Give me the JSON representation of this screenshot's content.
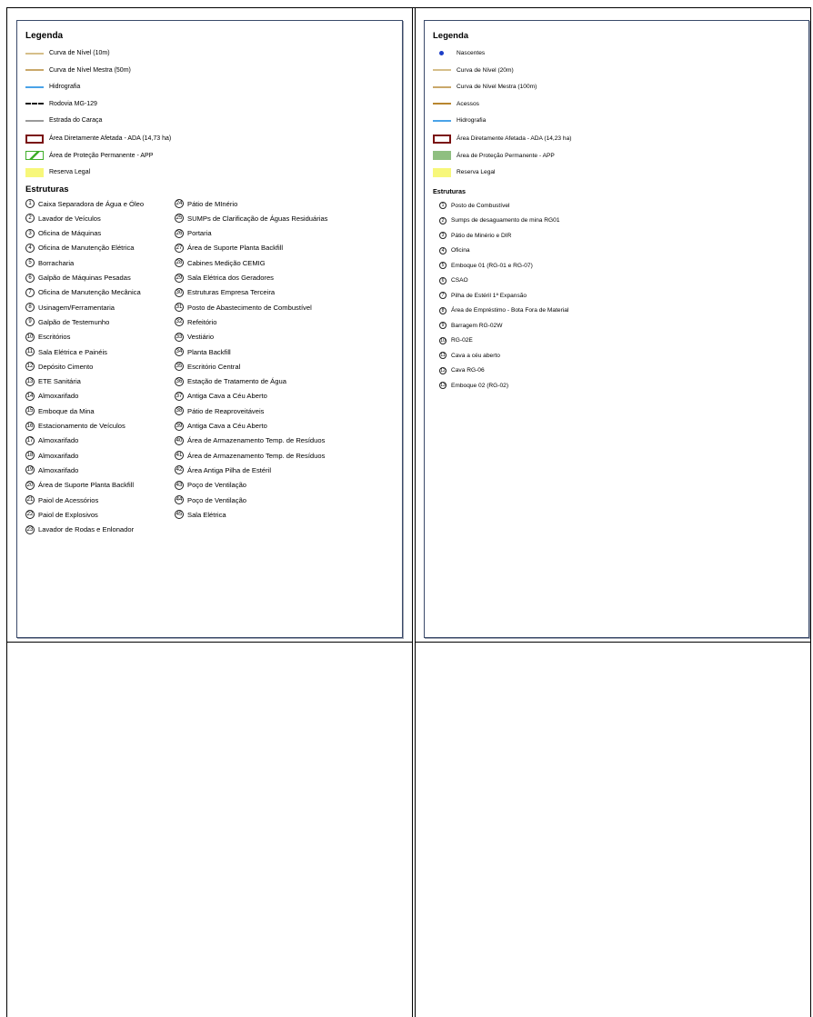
{
  "left": {
    "legend_title": "Legenda",
    "legend": [
      {
        "label": "Curva de Nível (10m)",
        "symbol": "line",
        "color": "#d6bf8a"
      },
      {
        "label": "Curva de Nível Mestra (50m)",
        "symbol": "line",
        "color": "#c9a86a"
      },
      {
        "label": "Hidrografia",
        "symbol": "line",
        "color": "#4aa3e8"
      },
      {
        "label": "Rodovia MG-129",
        "symbol": "dash",
        "color": "#1a1a1a"
      },
      {
        "label": "Estrada do Caraça",
        "symbol": "line",
        "color": "#9a9a9a"
      },
      {
        "label": "Área Diretamente Afetada - ADA (14,73 ha)",
        "symbol": "box-outline",
        "color": "#7a1111"
      },
      {
        "label": "Área de Proteção Permanente - APP",
        "symbol": "box-hatch",
        "color": "#3fae2a"
      },
      {
        "label": "Reserva Legal",
        "symbol": "box-fill",
        "color": "#f7f77a"
      }
    ],
    "structures_title": "Estruturas",
    "structures": [
      "Caixa Separadora de Água e Óleo",
      "Lavador de Veículos",
      "Oficina de Máquinas",
      "Oficina de Manutenção Elétrica",
      "Borracharia",
      "Galpão de Máquinas Pesadas",
      "Oficina de Manutenção Mecânica",
      "Usinagem/Ferramentaria",
      "Galpão de Testemunho",
      "Escritórios",
      "Sala Elétrica e Painéis",
      "Depósito Cimento",
      "ETE Sanitária",
      "Almoxarifado",
      "Emboque da Mina",
      "Estacionamento de Veículos",
      "Almoxarifado",
      "Almoxarifado",
      "Almoxarifado",
      "Área de Suporte Planta Backfill",
      "Paiol de Acessórios",
      "Paiol de Explosivos",
      "Lavador de Rodas e Enlonador",
      "Pátio de MInério",
      "SUMPs de Clarificação de Águas Residuárias",
      "Portaria",
      "Área de Suporte Planta Backfill",
      "Cabines Medição CEMIG",
      "Sala Elétrica dos Geradores",
      "Estruturas Empresa Terceira",
      "Posto de Abastecimento de Combustível",
      "Refeitório",
      "Vestiário",
      "Planta Backfill",
      "Escritório Central",
      "Estação de Tratamento de Água",
      "Antiga Cava a Céu Aberto",
      "Pátio de Reaproveitáveis",
      "Antiga Cava a Céu Aberto",
      "Área de Armazenamento Temp. de Resíduos",
      "Área de Armazenamento Temp. de Resíduos",
      "Área Antiga Pilha de Estéril",
      "Poço de Ventilação",
      "Poço de Ventilação",
      "Sala Elétrica"
    ]
  },
  "right": {
    "legend_title": "Legenda",
    "legend": [
      {
        "label": "Nascentes",
        "symbol": "dot",
        "color": "#1c3ec7"
      },
      {
        "label": "Curva de Nível (20m)",
        "symbol": "line",
        "color": "#d6bf8a"
      },
      {
        "label": "Curva de Nível Mestra (100m)",
        "symbol": "line",
        "color": "#c9a86a"
      },
      {
        "label": "Acessos",
        "symbol": "line",
        "color": "#b8862f"
      },
      {
        "label": "Hidrografia",
        "symbol": "line",
        "color": "#4aa3e8"
      },
      {
        "label": "Área Diretamente Afetada - ADA (14,23 ha)",
        "symbol": "box-outline",
        "color": "#7a1111"
      },
      {
        "label": "Área de Proteção Permanente - APP",
        "symbol": "box-fill",
        "color": "#8fbf80"
      },
      {
        "label": "Reserva Legal",
        "symbol": "box-fill",
        "color": "#f7f77a"
      }
    ],
    "structures_title": "Estruturas",
    "structures": [
      "Posto de Combustível",
      "Sumps de desaguamento de mina RG01",
      "Pátio de Minério e DIR",
      "Oficina",
      "Emboque 01 (RG-01 e RG-07)",
      "CSAO",
      "Pilha de Estéril 1ª Expansão",
      "Área de Empréstimo - Bota Fora de Material",
      "Barragem RG-02W",
      "RG-02E",
      "Cava a céu aberto",
      "Cava RG-06",
      "Emboque 02 (RG-02)"
    ]
  }
}
